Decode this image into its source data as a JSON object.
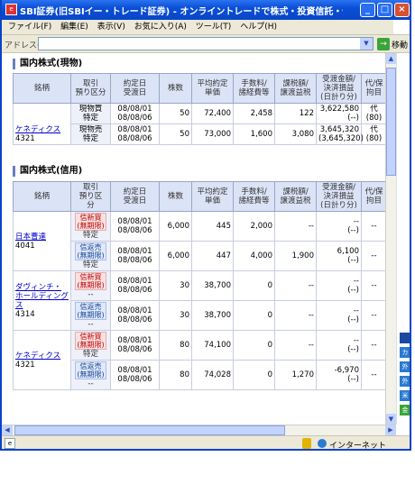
{
  "window": {
    "title": "SBI証券(旧SBIイー・トレード証券) - オンライントレードで株式・投資信託・債券を ... - Mic..."
  },
  "menu": [
    "ファイル(F)",
    "編集(E)",
    "表示(V)",
    "お気に入り(A)",
    "ツール(T)",
    "ヘルプ(H)"
  ],
  "address": {
    "label": "アドレス(D)",
    "value": "",
    "go_label": "移動"
  },
  "cash_section": {
    "title": "国内株式(現物)",
    "headers": [
      "銘柄",
      "取引\n預り区分",
      "約定日\n受渡日",
      "株数",
      "平均約定\n単価",
      "手数料/\n諸経費等",
      "課税額/\n譲渡益税",
      "受渡金額/\n決済損益\n(日計り分)",
      "代/保\n拘目"
    ],
    "rows": [
      {
        "name": "ケネディクス",
        "code": "4321",
        "type": "現物買",
        "account": "特定",
        "date1": "08/08/01",
        "date2": "08/08/06",
        "shares": "50",
        "price": "72,400",
        "fee": "2,458",
        "tax": "122",
        "amount": "3,622,580",
        "pl": "(--)",
        "col9a": "代",
        "col9b": "(80)"
      },
      {
        "name": "",
        "code": "",
        "type": "現物売",
        "account": "特定",
        "date1": "08/08/01",
        "date2": "08/08/06",
        "shares": "50",
        "price": "73,000",
        "fee": "1,600",
        "tax": "3,080",
        "amount": "3,645,320",
        "pl": "(3,645,320)",
        "col9a": "代",
        "col9b": "(80)"
      }
    ]
  },
  "margin_section": {
    "title": "国内株式(信用)",
    "headers": [
      "銘柄",
      "取引\n預り区\n分",
      "約定日\n受渡日",
      "株数",
      "平均約定\n単価",
      "手数料/\n諸経費等",
      "課税額/\n譲渡益税",
      "受渡金額/\n決済損益\n(日計り分)",
      "代/保\n拘目"
    ],
    "rows": [
      {
        "name": "日本曹達",
        "code": "4041",
        "type1": "信新買",
        "type2": "(無期限)",
        "account": "特定",
        "date1": "08/08/01",
        "date2": "08/08/06",
        "shares": "6,000",
        "price": "445",
        "fee": "2,000",
        "tax": "--",
        "amount": "--",
        "pl": "(--)",
        "col9": "--",
        "tag": "red"
      },
      {
        "name": "",
        "code": "",
        "type1": "信返売",
        "type2": "(無期限)",
        "account": "特定",
        "date1": "08/08/01",
        "date2": "08/08/06",
        "shares": "6,000",
        "price": "447",
        "fee": "4,000",
        "tax": "1,900",
        "amount": "6,100",
        "pl": "(--)",
        "col9": "--",
        "tag": "blue"
      },
      {
        "name": "ダヴィンチ・ホールディングス",
        "code": "4314",
        "type1": "信新買",
        "type2": "(無期限)",
        "account": "--",
        "date1": "08/08/01",
        "date2": "08/08/06",
        "shares": "30",
        "price": "38,700",
        "fee": "0",
        "tax": "--",
        "amount": "--",
        "pl": "(--)",
        "col9": "--",
        "tag": "red"
      },
      {
        "name": "",
        "code": "",
        "type1": "信返売",
        "type2": "(無期限)",
        "account": "--",
        "date1": "08/08/01",
        "date2": "08/08/06",
        "shares": "30",
        "price": "38,700",
        "fee": "0",
        "tax": "--",
        "amount": "--",
        "pl": "(--)",
        "col9": "--",
        "tag": "blue"
      },
      {
        "name": "ケネディクス",
        "code": "4321",
        "type1": "信新買",
        "type2": "(無期限)",
        "account": "特定",
        "date1": "08/08/01",
        "date2": "08/08/06",
        "shares": "80",
        "price": "74,100",
        "fee": "0",
        "tax": "--",
        "amount": "--",
        "pl": "(--)",
        "col9": "--",
        "tag": "red"
      },
      {
        "name": "",
        "code": "",
        "type1": "信返売",
        "type2": "(無期限)",
        "account": "--",
        "date1": "08/08/01",
        "date2": "08/08/06",
        "shares": "80",
        "price": "74,028",
        "fee": "0",
        "tax": "1,270",
        "amount": "-6,970",
        "pl": "(--)",
        "col9": "--",
        "tag": "blue"
      }
    ]
  },
  "status": {
    "zone": "インターネット"
  },
  "colors": {
    "titlebar": "#0a4fd6",
    "header_bg": "#dbe3f6",
    "link": "#0000cc"
  }
}
